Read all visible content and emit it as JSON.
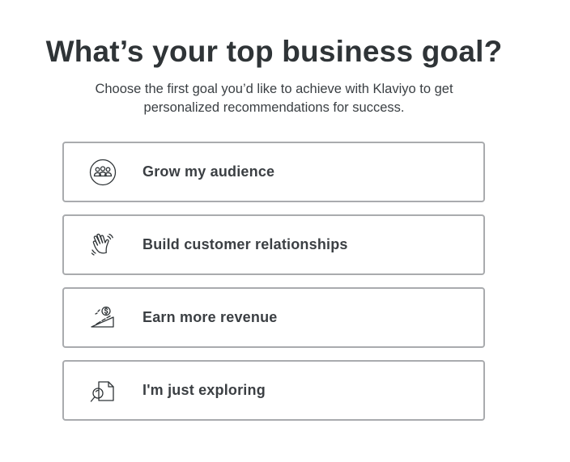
{
  "header": {
    "title": "What’s your top business goal?",
    "subtitle": "Choose the first goal you’d like to achieve with Klaviyo to get personalized recommendations for success."
  },
  "goals": [
    {
      "label": "Grow my audience",
      "icon": "audience-group-icon"
    },
    {
      "label": "Build customer relationships",
      "icon": "waving-hand-icon"
    },
    {
      "label": "Earn more revenue",
      "icon": "revenue-growth-icon"
    },
    {
      "label": "I'm just exploring",
      "icon": "document-search-icon"
    }
  ],
  "colors": {
    "title": "#2f3437",
    "text": "#3b3f43",
    "card_border": "#a9abae",
    "background": "#ffffff"
  }
}
